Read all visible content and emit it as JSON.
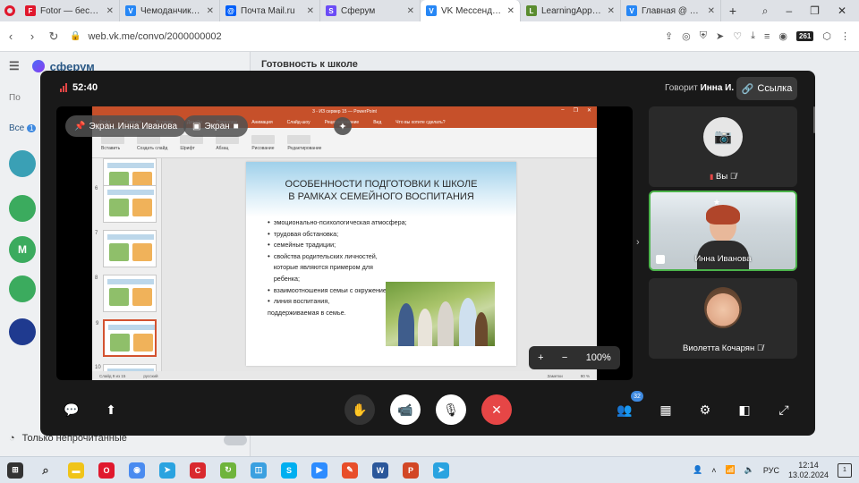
{
  "browser": {
    "tabs": [
      {
        "label": "Fotor — бесплатный с",
        "color": "#e0182d",
        "glyph": "F"
      },
      {
        "label": "Чемоданчик детского",
        "color": "#2787f5",
        "glyph": "V"
      },
      {
        "label": "Почта Mail.ru",
        "color": "#005ff9",
        "glyph": "@"
      },
      {
        "label": "Сферум",
        "color": "#6b4cf6",
        "glyph": "S"
      },
      {
        "label": "VK Мессенджер",
        "color": "#2787f5",
        "glyph": "V"
      },
      {
        "label": "LearningApps.org - со",
        "color": "#5a8c2f",
        "glyph": "L"
      },
      {
        "label": "Главная @ Формы",
        "color": "#2787f5",
        "glyph": "V"
      }
    ],
    "close_glyph": "✕",
    "new_tab_glyph": "+",
    "window_controls": [
      "⌕",
      "–",
      "❐",
      "✕"
    ],
    "url": "web.vk.me/convo/2000000002",
    "ext_badge": "261"
  },
  "background_page": {
    "brand": "сферум",
    "search_placeholder": "По",
    "filter_label": "Все",
    "filter_count": "1",
    "conversation_title": "Готовность к школе",
    "unread_label": "Только непрочитанные",
    "avatars": [
      {
        "letter": "",
        "color": "#3aa0b5"
      },
      {
        "letter": "",
        "color": "#3bab5e"
      },
      {
        "letter": "M",
        "color": "#3bab5e"
      },
      {
        "letter": "",
        "color": "#3bab5e"
      },
      {
        "letter": "",
        "color": "#1f3a8f"
      }
    ]
  },
  "call": {
    "timer": "52:40",
    "speaking_prefix": "Говорит",
    "speaking_name": "Инна И.",
    "link_button": "Ссылка",
    "screen_share_label": "Экран",
    "presenter_name": "Инна Иванова",
    "zoom_level": "100%",
    "zoom_plus": "+",
    "zoom_minus": "−"
  },
  "presentation": {
    "window_title": "3 - ИЗ сервер 15 — PowerPoint",
    "menu": [
      "Файл",
      "Главная",
      "Вставка",
      "Дизайн",
      "Переходы",
      "Анимация",
      "Слайд-шоу",
      "Рецензирование",
      "Вид",
      "Что вы хотите сделать?"
    ],
    "ribbon_groups": [
      "Вставить",
      "Создать слайд",
      "Шрифт",
      "Абзац",
      "Рисование",
      "Редактирование"
    ],
    "slide_numbers": [
      "6",
      "7",
      "8",
      "9",
      "10"
    ],
    "slide_title_line1": "ОСОБЕННОСТИ ПОДГОТОВКИ К ШКОЛЕ",
    "slide_title_line2": "В РАМКАХ СЕМЕЙНОГО ВОСПИТАНИЯ",
    "bullets": [
      "эмоционально-психологическая атмосфера;",
      "трудовая обстановка;",
      "семейные традиции;",
      "свойства родительских личностей, которые являются примером для ребенка;",
      "взаимоотношения семьи с окружением;",
      "линия воспитания,"
    ],
    "bullet_tail": "поддерживаемая в семье.",
    "status_left": "Слайд 9 из 15",
    "status_lang": "русский",
    "status_notes": "Заметки",
    "status_zoom": "90 %"
  },
  "participants": [
    {
      "name": "Вы",
      "muted": true,
      "camera_off": true
    },
    {
      "name": "Инна Иванова",
      "muted": false,
      "camera_off": false
    },
    {
      "name": "Виолетта Кочарян",
      "muted": true,
      "camera_off": false
    }
  ],
  "controls": {
    "participants_count": "32"
  },
  "taskbar": {
    "time": "12:14",
    "date": "13.02.2024",
    "lang": "РУС",
    "notifications": "1",
    "apps": [
      {
        "color": "#f0c419",
        "glyph": "▬"
      },
      {
        "color": "#e0182d",
        "glyph": "O"
      },
      {
        "color": "#4a8bf0",
        "glyph": "◉"
      },
      {
        "color": "#2aa3e0",
        "glyph": "➤"
      },
      {
        "color": "#d9292e",
        "glyph": "C"
      },
      {
        "color": "#6fb43c",
        "glyph": "↻"
      },
      {
        "color": "#3ba0e0",
        "glyph": "◫"
      },
      {
        "color": "#00aff0",
        "glyph": "S"
      },
      {
        "color": "#2d8cff",
        "glyph": "▶"
      },
      {
        "color": "#e84e2a",
        "glyph": "✎"
      },
      {
        "color": "#2b579a",
        "glyph": "W"
      },
      {
        "color": "#d24726",
        "glyph": "P"
      },
      {
        "color": "#2aa3e0",
        "glyph": "➤"
      }
    ]
  },
  "colors": {
    "accent_red": "#e64646",
    "active_border": "#4bb34b",
    "ppt_orange": "#c6502a",
    "vk_blue": "#2787f5"
  }
}
